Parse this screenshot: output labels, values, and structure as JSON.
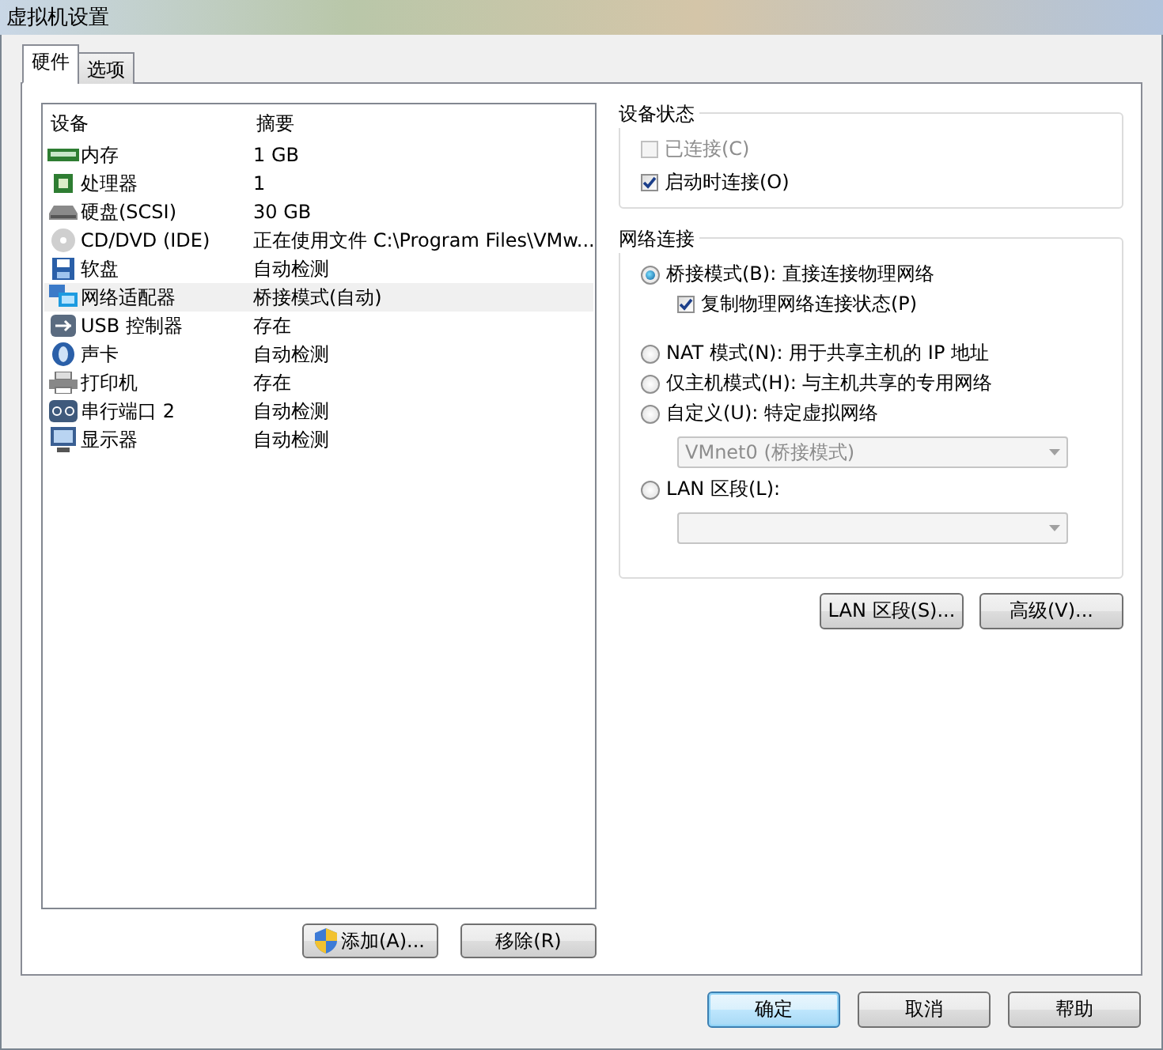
{
  "window": {
    "title": "虚拟机设置"
  },
  "tabs": [
    {
      "label": "硬件",
      "selected": true
    },
    {
      "label": "选项",
      "selected": false
    }
  ],
  "devices": {
    "columns": [
      "设备",
      "摘要"
    ],
    "rows": [
      {
        "name": "内存",
        "summary": "1 GB",
        "selected": false
      },
      {
        "name": "处理器",
        "summary": "1",
        "selected": false
      },
      {
        "name": "硬盘(SCSI)",
        "summary": "30 GB",
        "selected": false
      },
      {
        "name": "CD/DVD (IDE)",
        "summary": "正在使用文件 C:\\Program Files\\VMw...",
        "selected": false
      },
      {
        "name": "软盘",
        "summary": "自动检测",
        "selected": false
      },
      {
        "name": "网络适配器",
        "summary": "桥接模式(自动)",
        "selected": true
      },
      {
        "name": "USB 控制器",
        "summary": "存在",
        "selected": false
      },
      {
        "name": "声卡",
        "summary": "自动检测",
        "selected": false
      },
      {
        "name": "打印机",
        "summary": "存在",
        "selected": false
      },
      {
        "name": "串行端口 2",
        "summary": "自动检测",
        "selected": false
      },
      {
        "name": "显示器",
        "summary": "自动检测",
        "selected": false
      }
    ],
    "buttons": [
      "添加(A)...",
      "移除(R)"
    ]
  },
  "device_status": {
    "title": "设备状态",
    "options": [
      {
        "label": "已连接(C)",
        "checked": false,
        "disabled": true
      },
      {
        "label": "启动时连接(O)",
        "checked": true,
        "disabled": false
      }
    ]
  },
  "network": {
    "title": "网络连接",
    "items": [
      {
        "kind": "radio",
        "label": "桥接模式(B): 直接连接物理网络",
        "selected": true
      },
      {
        "kind": "checkbox",
        "label": "复制物理网络连接状态(P)",
        "checked": true
      },
      {
        "kind": "radio",
        "label": "NAT 模式(N): 用于共享主机的 IP 地址",
        "selected": false
      },
      {
        "kind": "radio",
        "label": "仅主机模式(H): 与主机共享的专用网络",
        "selected": false
      },
      {
        "kind": "radio",
        "label": "自定义(U): 特定虚拟网络",
        "selected": false
      },
      {
        "kind": "dropdown",
        "value": "VMnet0 (桥接模式)",
        "disabled": true
      },
      {
        "kind": "radio",
        "label": "LAN 区段(L):",
        "selected": false
      },
      {
        "kind": "dropdown",
        "disabled": true
      }
    ],
    "buttons": [
      "LAN 区段(S)...",
      "高级(V)..."
    ]
  },
  "dialog_buttons": [
    {
      "label": "确定",
      "default": true
    },
    {
      "label": "取消",
      "default": false
    },
    {
      "label": "帮助",
      "default": false
    }
  ]
}
